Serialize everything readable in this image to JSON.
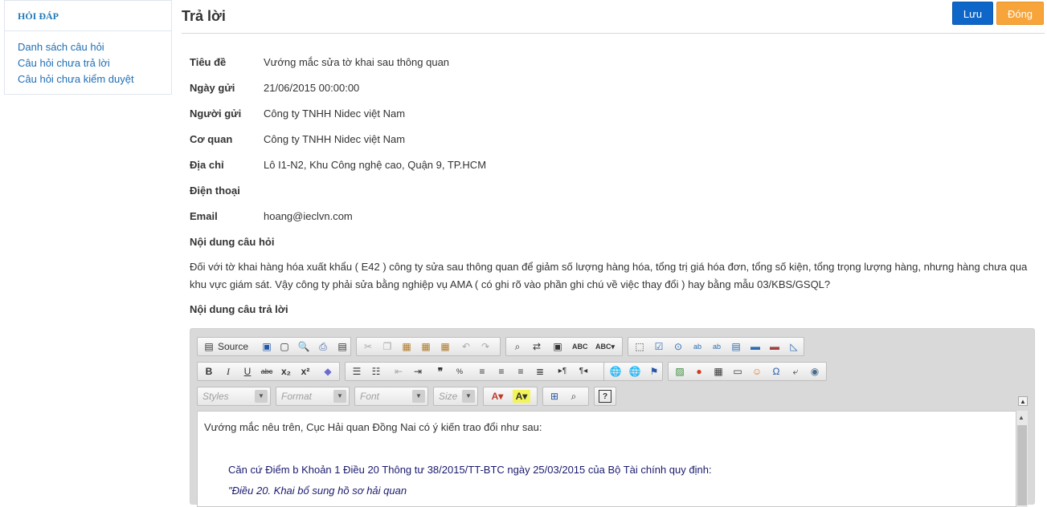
{
  "sidebar": {
    "title": "HỎI ĐÁP",
    "links": [
      "Danh sách câu hỏi",
      "Câu hỏi chưa trả lời",
      "Câu hỏi chưa kiểm duyệt"
    ]
  },
  "header": {
    "title": "Trả lời",
    "save_label": "Lưu",
    "close_label": "Đóng"
  },
  "question": {
    "fields": [
      {
        "label": "Tiêu đề",
        "value": "Vướng mắc sửa tờ khai sau thông quan"
      },
      {
        "label": "Ngày gửi",
        "value": "21/06/2015 00:00:00"
      },
      {
        "label": "Người gửi",
        "value": "Công ty TNHH Nidec việt Nam"
      },
      {
        "label": "Cơ quan",
        "value": "Công ty TNHH Nidec việt Nam"
      },
      {
        "label": "Địa chỉ",
        "value": "Lô I1-N2, Khu Công nghệ cao, Quận 9, TP.HCM"
      },
      {
        "label": "Điện thoại",
        "value": ""
      },
      {
        "label": "Email",
        "value": "hoang@ieclvn.com"
      }
    ],
    "content_label": "Nội dung câu hỏi",
    "content": "Đối với tờ khai hàng hóa xuất khẩu ( E42 ) công ty sửa sau thông quan để giảm số lượng hàng hóa, tổng trị giá hóa đơn, tổng số kiện, tổng trọng lượng hàng, nhưng hàng chưa qua khu vực giám sát. Vậy công ty phải sửa bằng nghiệp vụ AMA ( có ghi rõ vào phần ghi chú về việc thay đổi ) hay bằng mẫu 03/KBS/GSQL?",
    "answer_label": "Nội dung câu trả lời"
  },
  "editor": {
    "source_label": "Source",
    "styles_label": "Styles",
    "format_label": "Format",
    "font_label": "Font",
    "size_label": "Size",
    "answer_lines": [
      "Vướng mắc nêu trên, Cục Hải quan Đồng Nai có ý kiến trao đổi như sau:",
      "Căn cứ Điểm b Khoản 1 Điều 20 Thông tư 38/2015/TT-BTC ngày 25/03/2015 của Bộ Tài chính quy định:",
      "\"Điều 20. Khai bổ sung hồ sơ hải quan"
    ]
  }
}
